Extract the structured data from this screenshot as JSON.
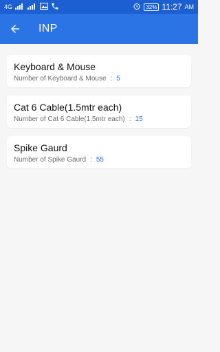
{
  "status_bar": {
    "network": "4G",
    "battery": "32%",
    "time": "11:27",
    "ampm": "AM"
  },
  "app_bar": {
    "title": "INP"
  },
  "items": [
    {
      "title": "Keyboard & Mouse",
      "label": "Number of Keyboard & Mouse",
      "colon": ":",
      "value": "5"
    },
    {
      "title": "Cat 6 Cable(1.5mtr each)",
      "label": "Number of Cat 6 Cable(1.5mtr each)",
      "colon": ":",
      "value": "15"
    },
    {
      "title": "Spike Gaurd",
      "label": "Number of Spike Gaurd",
      "colon": ":",
      "value": "55"
    }
  ],
  "colors": {
    "status_bar": "#1b5fd3",
    "app_bar": "#2b74e6",
    "value": "#2b74e6",
    "background": "#f6f6f6"
  },
  "icons": [
    "signal-icon",
    "image-icon",
    "phone-icon",
    "alarm-icon",
    "battery-icon",
    "back-arrow-icon"
  ]
}
